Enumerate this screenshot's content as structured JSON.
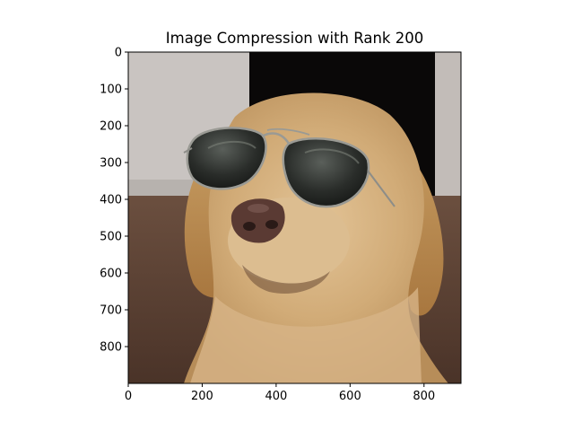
{
  "chart_data": {
    "type": "image",
    "title": "Image Compression with Rank 200",
    "xlabel": "",
    "ylabel": "",
    "xlim": [
      0,
      900
    ],
    "ylim": [
      900,
      0
    ],
    "xticks": [
      0,
      200,
      400,
      600,
      800
    ],
    "yticks": [
      0,
      100,
      200,
      300,
      400,
      500,
      600,
      700,
      800
    ],
    "image_subject": "yellow labrador dog wearing aviator sunglasses",
    "grid": false
  }
}
